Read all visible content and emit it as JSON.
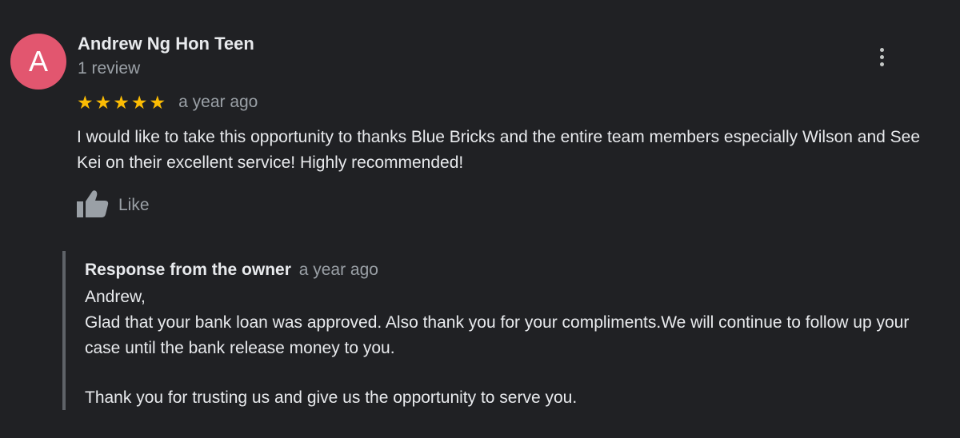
{
  "review": {
    "avatar_letter": "A",
    "avatar_color": "#e2566f",
    "author_name": "Andrew Ng Hon Teen",
    "review_count": "1 review",
    "rating": 5,
    "rating_max": 5,
    "star_color": "#fbbc04",
    "date": "a year ago",
    "text": "I would like to take this opportunity to thanks Blue Bricks and the entire team members especially Wilson and See Kei on their excellent service! Highly recommended!",
    "like_label": "Like",
    "menu_icon": "more-vert-icon"
  },
  "owner_response": {
    "title": "Response from the owner",
    "date": "a year ago",
    "greeting": "Andrew,",
    "paragraph_1": "Glad that your bank loan was approved. Also thank you for your compliments.We will continue to follow up your case until the bank release money to you.",
    "paragraph_2": "Thank you for trusting us and give us the opportunity to serve you."
  }
}
